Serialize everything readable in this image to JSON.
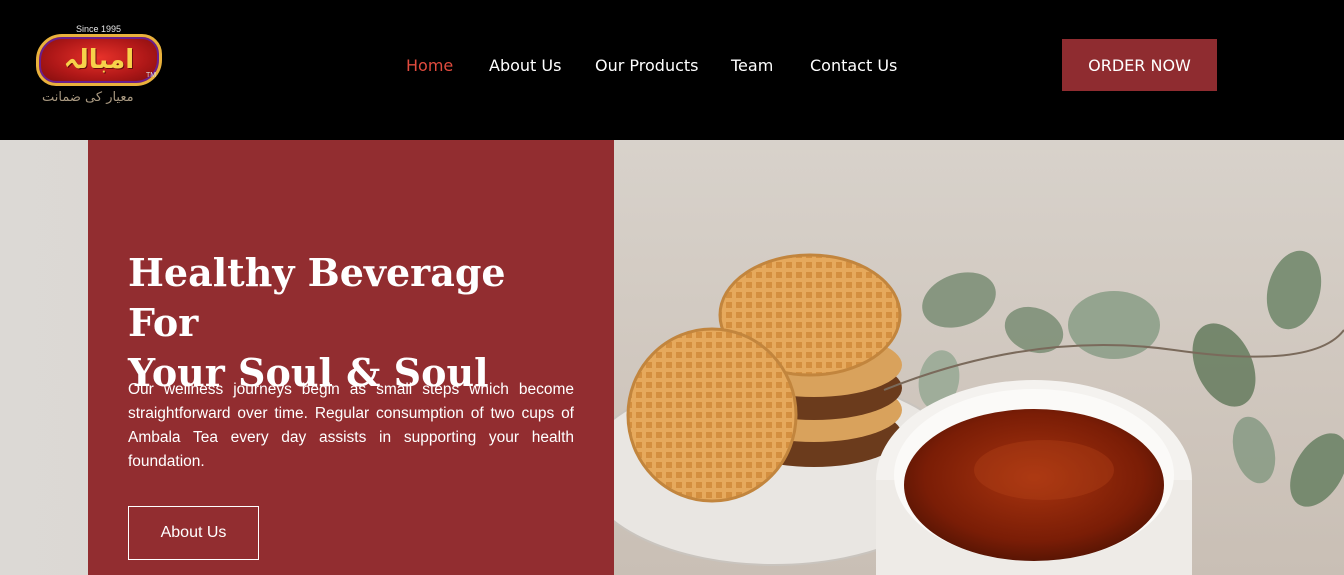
{
  "brand": {
    "since": "Since 1995",
    "name": "امبالہ",
    "tagline": "معیار کی ضمانت",
    "tm": "TM"
  },
  "nav": {
    "items": [
      {
        "label": "Home",
        "active": true
      },
      {
        "label": "About Us",
        "active": false
      },
      {
        "label": "Our Products",
        "active": false
      },
      {
        "label": "Team",
        "active": false
      },
      {
        "label": "Contact Us",
        "active": false
      }
    ]
  },
  "header": {
    "order_label": "ORDER NOW"
  },
  "hero": {
    "title_line1": "Healthy Beverage For",
    "title_line2": "Your Soul & Soul",
    "body": "Our wellness journeys begin as small steps which become straightforward over time. Regular consumption of two cups of Ambala Tea every day assists in supporting your health foundation.",
    "button_label": "About Us"
  },
  "colors": {
    "header_bg": "#000000",
    "accent": "#922d30",
    "nav_active": "#e14b3e",
    "text_light": "#ffffff"
  }
}
